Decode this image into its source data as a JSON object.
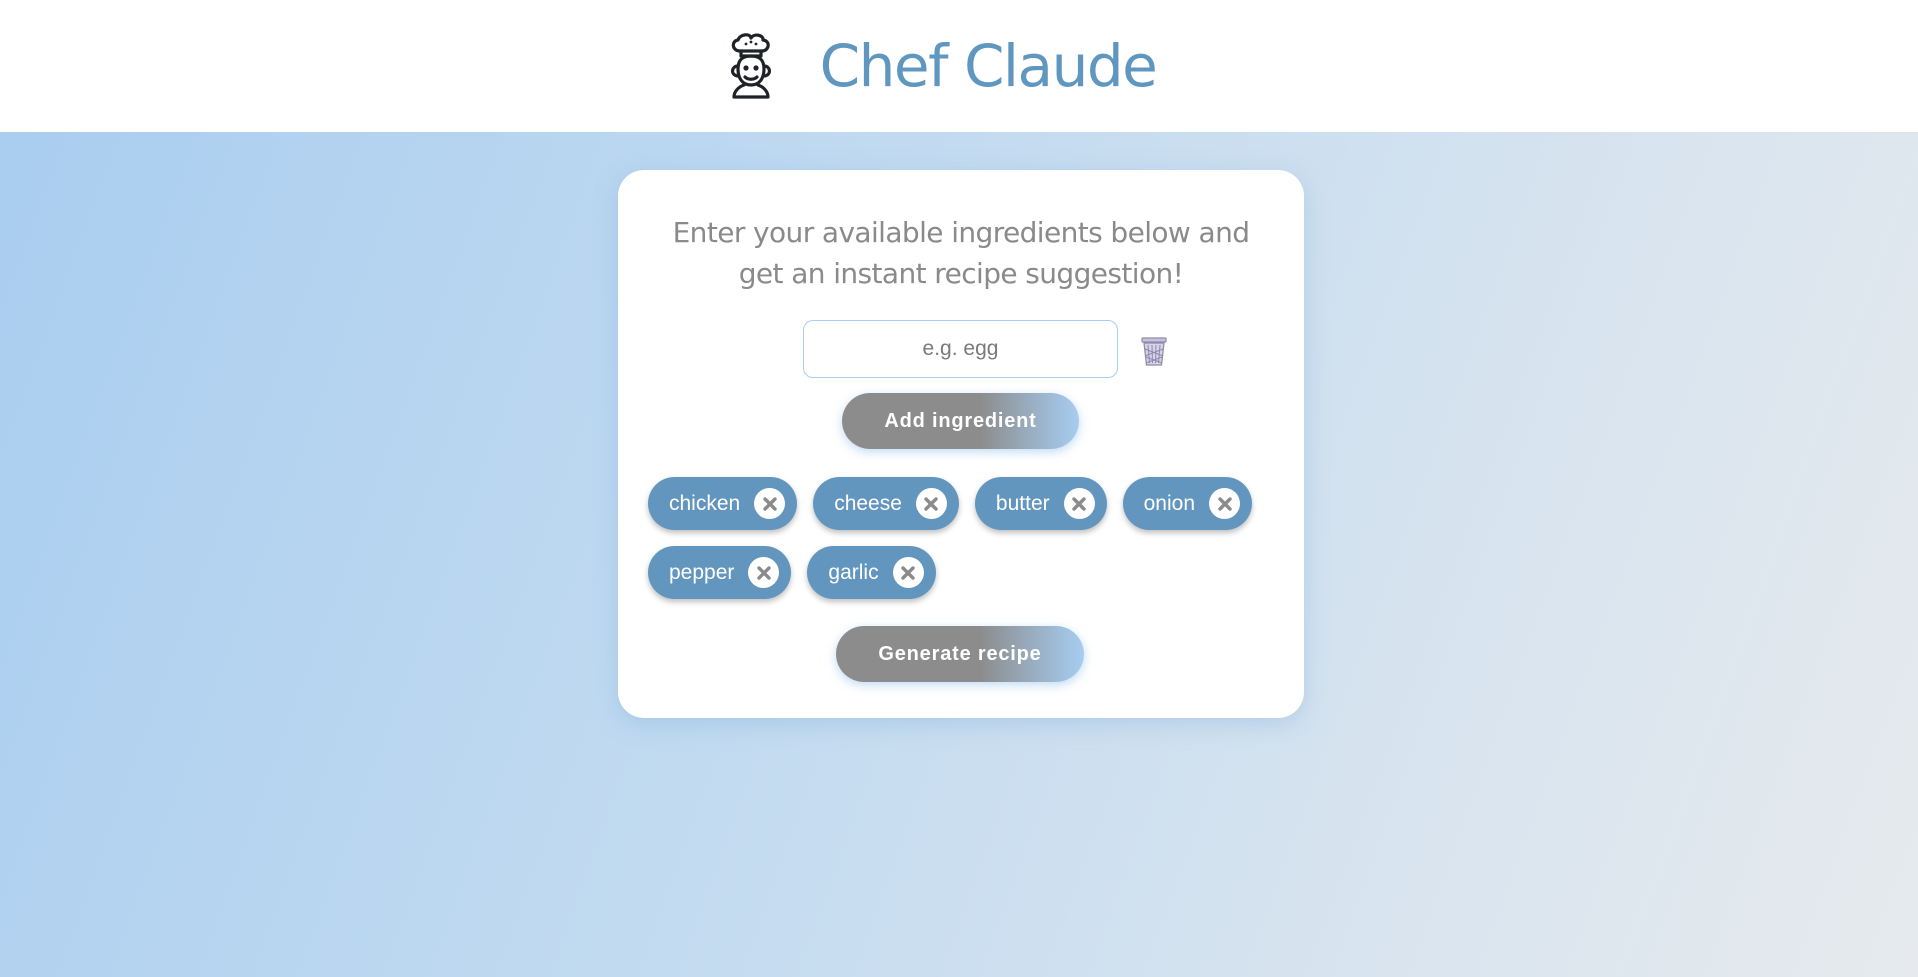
{
  "header": {
    "title": "Chef Claude",
    "logo_icon": "chef-robot-icon"
  },
  "form": {
    "intro": "Enter your available ingredients below and get an instant recipe suggestion!",
    "input_placeholder": "e.g. egg",
    "input_value": "",
    "clear_icon": "trash-icon",
    "add_label": "Add ingredient"
  },
  "ingredients": [
    {
      "label": "chicken"
    },
    {
      "label": "cheese"
    },
    {
      "label": "butter"
    },
    {
      "label": "onion"
    },
    {
      "label": "pepper"
    },
    {
      "label": "garlic"
    }
  ],
  "generate_label": "Generate recipe",
  "colors": {
    "brand": "#5f97c0",
    "chip": "#6396be",
    "button": "#8c8c8c",
    "text_muted": "#8a8a8a"
  }
}
